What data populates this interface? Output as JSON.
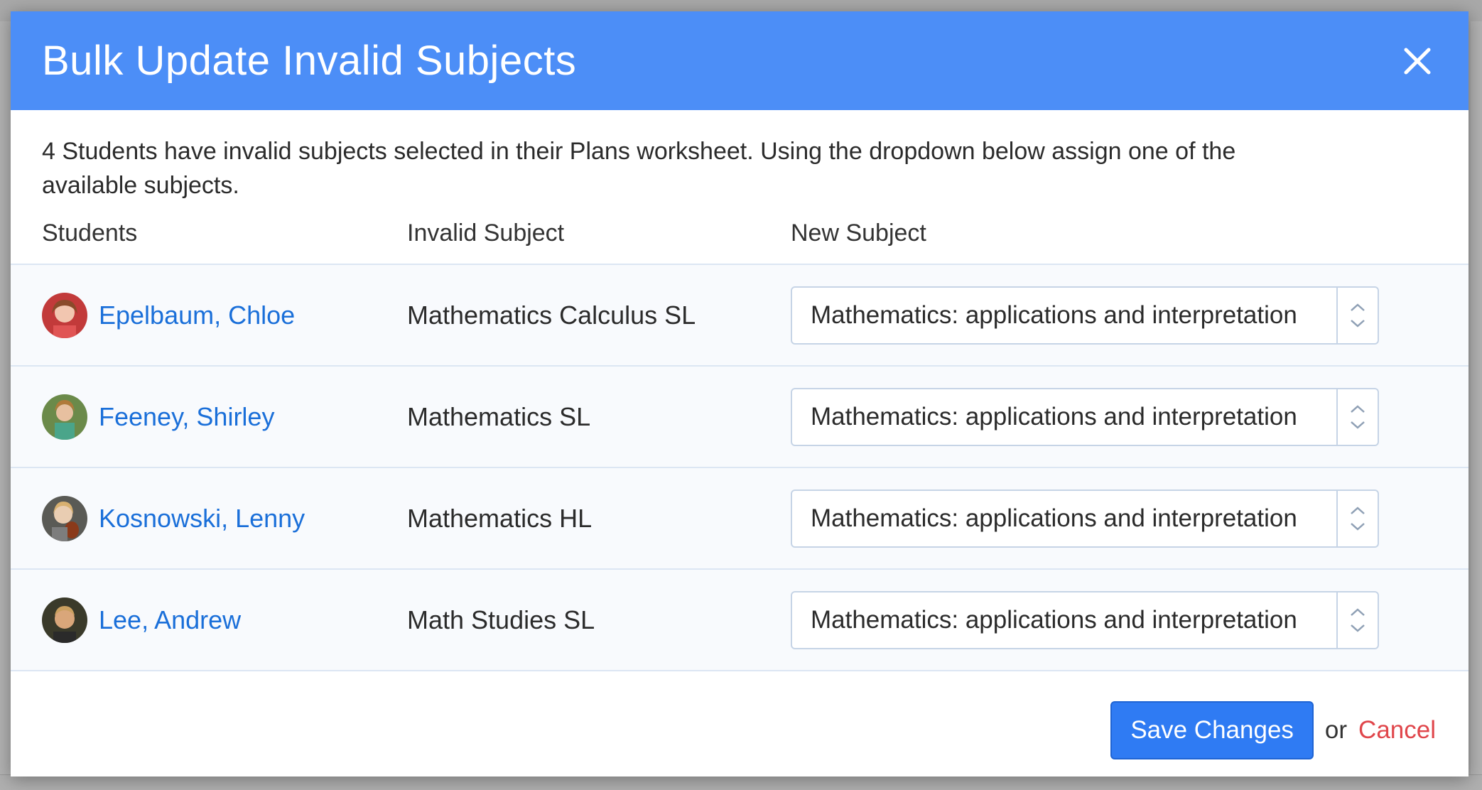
{
  "modal": {
    "title": "Bulk Update Invalid Subjects",
    "close_icon": "close-icon",
    "intro": "4 Students have invalid subjects selected in their Plans worksheet. Using the dropdown below assign one of the available subjects."
  },
  "table": {
    "headers": {
      "students": "Students",
      "invalid_subject": "Invalid Subject",
      "new_subject": "New Subject"
    },
    "rows": [
      {
        "student": "Epelbaum, Chloe",
        "invalid_subject": "Mathematics Calculus SL",
        "new_subject": "Mathematics: applications and interpretation"
      },
      {
        "student": "Feeney, Shirley",
        "invalid_subject": "Mathematics SL",
        "new_subject": "Mathematics: applications and interpretation"
      },
      {
        "student": "Kosnowski, Lenny",
        "invalid_subject": "Mathematics HL",
        "new_subject": "Mathematics: applications and interpretation"
      },
      {
        "student": "Lee, Andrew",
        "invalid_subject": "Math Studies SL",
        "new_subject": "Mathematics: applications and interpretation"
      }
    ]
  },
  "footer": {
    "save_label": "Save Changes",
    "or_label": "or",
    "cancel_label": "Cancel"
  },
  "colors": {
    "header_bg": "#4c8ef7",
    "link": "#1a6fd9",
    "save_bg": "#2f7bf3",
    "cancel": "#e0464b"
  }
}
